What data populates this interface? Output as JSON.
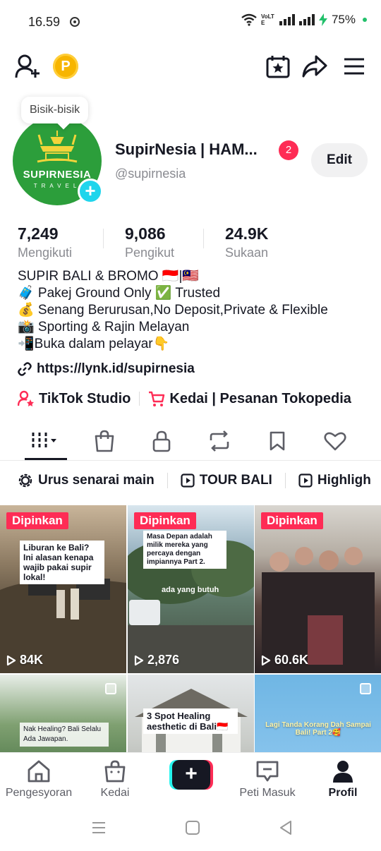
{
  "status_bar": {
    "time": "16.59",
    "network_label": "VoLTE",
    "battery": "75%"
  },
  "profile": {
    "tooltip": "Bisik-bisik",
    "avatar_text": "SUPIRNESIA",
    "avatar_sub": "TRAVEL",
    "display_name": "SupirNesia | HAM...",
    "notification_count": "2",
    "username": "@supirnesia",
    "edit_label": "Edit"
  },
  "stats": [
    {
      "value": "7,249",
      "label": "Mengikuti"
    },
    {
      "value": "9,086",
      "label": "Pengikut"
    },
    {
      "value": "24.9K",
      "label": "Sukaan"
    }
  ],
  "bio": [
    "SUPIR BALI & BROMO 🇮🇩|🇲🇾",
    "🧳 Pakej Ground Only ✅ Trusted",
    "💰 Senang Berurusan,No Deposit,Private & Flexible",
    "📸 Sporting & Rajin Melayan",
    "📲Buka dalam pelayar👇"
  ],
  "link": "https://lynk.id/supirnesia",
  "shortcuts": [
    {
      "label": "TikTok Studio",
      "icon": "person-star-icon"
    },
    {
      "label": "Kedai | Pesanan Tokopedia",
      "icon": "cart-icon"
    }
  ],
  "tabs": [
    {
      "name": "videos",
      "icon": "grid-icon"
    },
    {
      "name": "shop",
      "icon": "bag-icon"
    },
    {
      "name": "private",
      "icon": "lock-icon"
    },
    {
      "name": "reposts",
      "icon": "repost-icon"
    },
    {
      "name": "favorites",
      "icon": "bookmark-icon"
    },
    {
      "name": "liked",
      "icon": "heart-icon"
    }
  ],
  "playlists": [
    {
      "label": "Urus senarai main",
      "icon": "gear-icon"
    },
    {
      "label": "TOUR BALI",
      "icon": "play-icon"
    },
    {
      "label": "Highligh",
      "icon": "play-icon"
    }
  ],
  "videos": [
    {
      "pinned": "Dipinkan",
      "views": "84K",
      "caption": "Liburan ke Bali? Ini alasan kenapa wajib pakai supir lokal!"
    },
    {
      "pinned": "Dipinkan",
      "views": "2,876",
      "caption": "Masa Depan adalah milik mereka yang percaya dengan impiannya Part 2.",
      "overlay": "ada yang butuh"
    },
    {
      "pinned": "Dipinkan",
      "views": "60.6K"
    },
    {
      "caption": "Nak Healing? Bali Selalu Ada Jawapan."
    },
    {
      "caption": "3 Spot Healing aesthetic di Bali🇮🇩"
    },
    {
      "caption": "Lagi Tanda Korang Dah Sampai Bali! Part 2🥰"
    }
  ],
  "bottom_nav": [
    {
      "label": "Pengesyoran",
      "icon": "home-icon"
    },
    {
      "label": "Kedai",
      "icon": "shop-bag-icon"
    },
    {
      "label": "Peti Masuk",
      "icon": "inbox-icon"
    },
    {
      "label": "Profil",
      "icon": "profile-icon"
    }
  ],
  "create_label": "+",
  "colors": {
    "accent": "#fe2c55",
    "cyan": "#25f4ee",
    "avatar_green": "#2c9e3b",
    "coin": "#f7b500"
  }
}
